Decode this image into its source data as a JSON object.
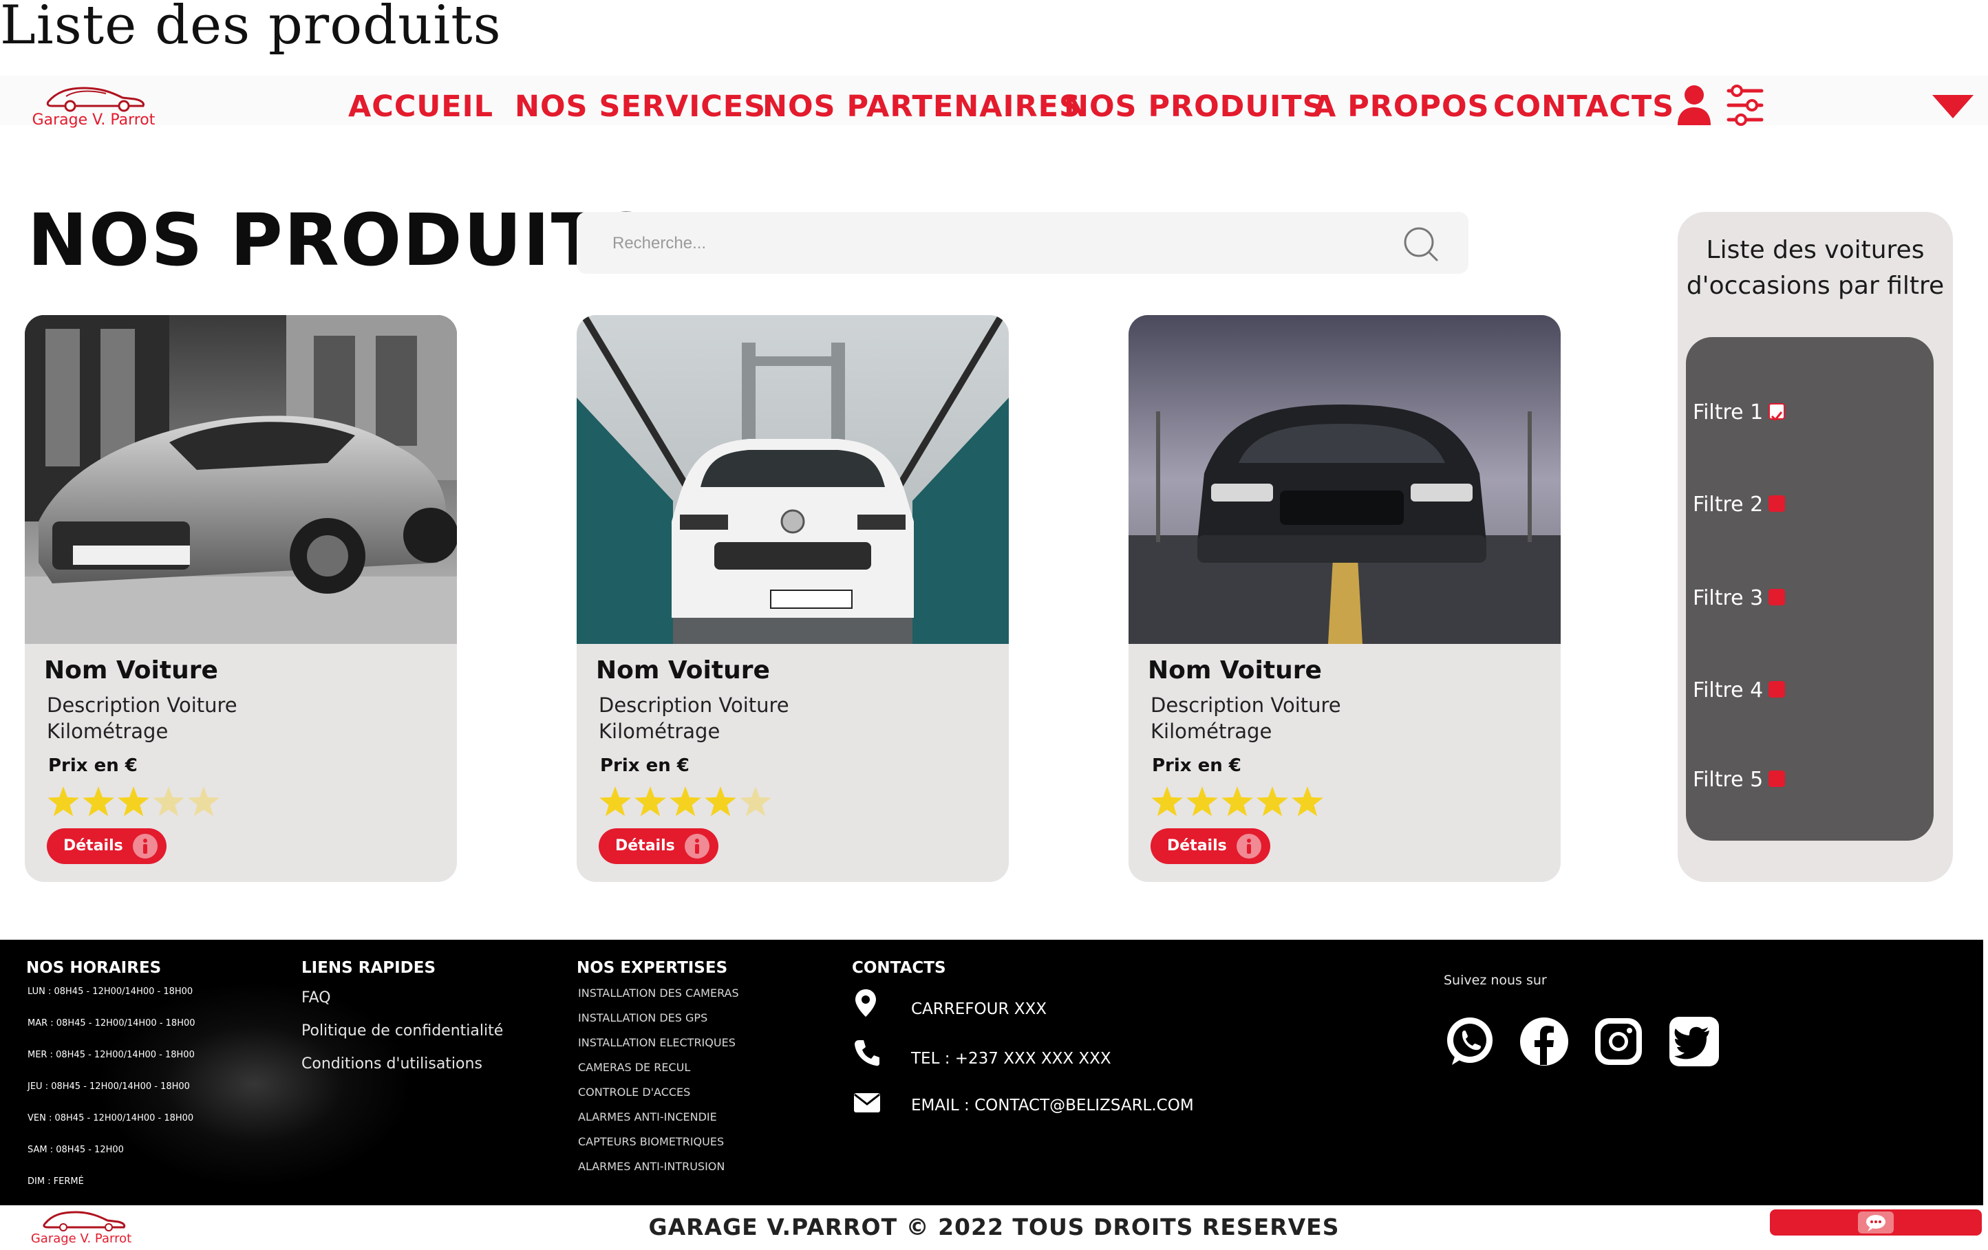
{
  "page": {
    "title": "Liste des produits"
  },
  "header": {
    "logo_text": "Garage V. Parrot",
    "nav": [
      {
        "label": "ACCUEIL"
      },
      {
        "label": "NOS SERVICES"
      },
      {
        "label": "NOS PARTENAIRES"
      },
      {
        "label": "NOS PRODUITS"
      },
      {
        "label": "A PROPOS"
      },
      {
        "label": "CONTACTS"
      }
    ],
    "icons": [
      "user-icon",
      "settings-sliders-icon",
      "caret-down-icon"
    ]
  },
  "main": {
    "heading": "NOS PRODUITS",
    "search": {
      "placeholder": "Recherche...",
      "value": ""
    },
    "products": [
      {
        "name": "Nom Voiture",
        "description": "Description Voiture",
        "mileage": "Kilométrage",
        "price": "Prix en €",
        "rating": 3,
        "rating_max": 5,
        "details_label": "Détails",
        "image": "grey-sports-coupe-photo"
      },
      {
        "name": "Nom Voiture",
        "description": "Description Voiture",
        "mileage": "Kilométrage",
        "price": "Prix en €",
        "rating": 4,
        "rating_max": 5,
        "details_label": "Détails",
        "image": "white-hatchback-on-bridge-photo"
      },
      {
        "name": "Nom Voiture",
        "description": "Description Voiture",
        "mileage": "Kilométrage",
        "price": "Prix en €",
        "rating": 5,
        "rating_max": 5,
        "details_label": "Détails",
        "image": "black-muscle-car-photo"
      }
    ],
    "filter_panel": {
      "title": "Liste des voitures d'occasions par filtre",
      "filters": [
        {
          "label": "Filtre 1",
          "checked": true
        },
        {
          "label": "Filtre 2",
          "checked": false
        },
        {
          "label": "Filtre 3",
          "checked": false
        },
        {
          "label": "Filtre 4",
          "checked": false
        },
        {
          "label": "Filtre 5",
          "checked": false
        }
      ]
    }
  },
  "footer": {
    "hours": {
      "heading": "NOS HORAIRES",
      "lines": [
        "LUN : 08H45 - 12H00/14H00 - 18H00",
        "MAR : 08H45 - 12H00/14H00 - 18H00",
        "MER : 08H45 - 12H00/14H00 - 18H00",
        "JEU : 08H45 - 12H00/14H00 - 18H00",
        "VEN : 08H45 - 12H00/14H00 - 18H00",
        "SAM : 08H45 - 12H00",
        "DIM : FERMÉ"
      ]
    },
    "quick_links": {
      "heading": "LIENS RAPIDES",
      "links": [
        "FAQ",
        "Politique de confidentialité",
        "Conditions d'utilisations"
      ]
    },
    "expertise": {
      "heading": "NOS EXPERTISES",
      "items": [
        "INSTALLATION DES CAMERAS",
        "INSTALLATION DES GPS",
        "INSTALLATION ELECTRIQUES",
        "CAMERAS DE RECUL",
        "CONTROLE D'ACCES",
        "ALARMES ANTI-INCENDIE",
        "CAPTEURS BIOMETRIQUES",
        "ALARMES ANTI-INTRUSION"
      ]
    },
    "contacts": {
      "heading": "CONTACTS",
      "address": "CARREFOUR XXX",
      "phone": "TEL : +237 XXX XXX XXX",
      "email": "EMAIL : CONTACT@BELIZSARL.COM"
    },
    "social": {
      "label": "Suivez nous sur",
      "networks": [
        "whatsapp-icon",
        "facebook-icon",
        "instagram-icon",
        "twitter-icon"
      ]
    },
    "logo_text": "Garage V. Parrot",
    "copyright": "GARAGE V.PARROT © 2022 TOUS DROITS RESERVES"
  },
  "colors": {
    "brand_red": "#e31b2d",
    "footer_bg": "#000000",
    "card_bg": "#e7e4e4",
    "filter_box_bg": "#5b5959",
    "star": "#f5d21f"
  }
}
